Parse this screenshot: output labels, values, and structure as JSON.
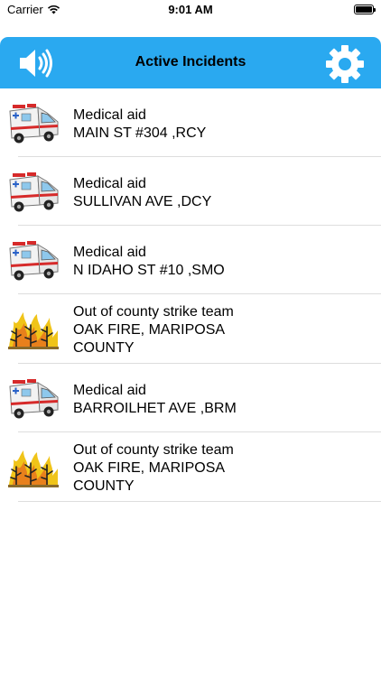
{
  "status_bar": {
    "carrier": "Carrier",
    "time": "9:01 AM"
  },
  "nav": {
    "title": "Active Incidents",
    "left_icon": "speaker-icon",
    "right_icon": "gear-icon",
    "bar_color": "#2aa9f0"
  },
  "incidents": [
    {
      "type": "Medical aid",
      "location": "MAIN ST #304 ,RCY",
      "icon": "ambulance-icon"
    },
    {
      "type": "Medical aid",
      "location": "SULLIVAN AVE ,DCY",
      "icon": "ambulance-icon"
    },
    {
      "type": "Medical aid",
      "location": "N IDAHO ST #10 ,SMO",
      "icon": "ambulance-icon"
    },
    {
      "type": "Out of county strike team",
      "location_line1": "OAK FIRE, MARIPOSA",
      "location_line2": "COUNTY",
      "icon": "wildfire-icon"
    },
    {
      "type": "Medical aid",
      "location": "BARROILHET AVE ,BRM",
      "icon": "ambulance-icon"
    },
    {
      "type": "Out of county strike team",
      "location_line1": "OAK FIRE, MARIPOSA",
      "location_line2": "COUNTY",
      "icon": "wildfire-icon"
    }
  ]
}
